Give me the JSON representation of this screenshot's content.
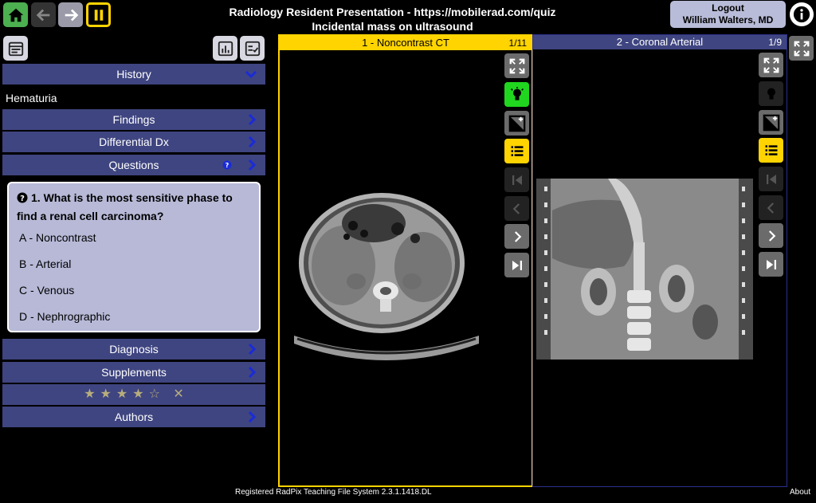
{
  "header": {
    "title_line1": "Radiology Resident Presentation - https://mobilerad.com/quiz",
    "title_line2": "Incidental mass on ultrasound",
    "logout_label": "Logout",
    "user_name": "William Walters, MD"
  },
  "sections": {
    "history_label": "History",
    "history_text": "Hematuria",
    "findings_label": "Findings",
    "ddx_label": "Differential Dx",
    "questions_label": "Questions",
    "diagnosis_label": "Diagnosis",
    "supplements_label": "Supplements",
    "authors_label": "Authors"
  },
  "question": {
    "text": "1. What is the most sensitive phase to find a renal cell carcinoma?",
    "options": [
      "A - Noncontrast",
      "B - Arterial",
      "C - Venous",
      "D - Nephrographic"
    ]
  },
  "rating": {
    "filled": 4,
    "total": 5,
    "stars_text": "★★★★☆",
    "clear_symbol": "✕"
  },
  "viewers": [
    {
      "label": "1 - Noncontrast CT",
      "count": "1/11"
    },
    {
      "label": "2 - Coronal Arterial",
      "count": "1/9"
    }
  ],
  "footer": {
    "registration": "Registered RadPix Teaching File System 2.3.1.1418.DL",
    "about": "About"
  },
  "colors": {
    "accent_yellow": "#ffd400",
    "bar_blue": "#3f4580",
    "question_bg": "#b7b9d7",
    "home_green": "#4caf50",
    "logout_bg": "#b9bcd8"
  }
}
